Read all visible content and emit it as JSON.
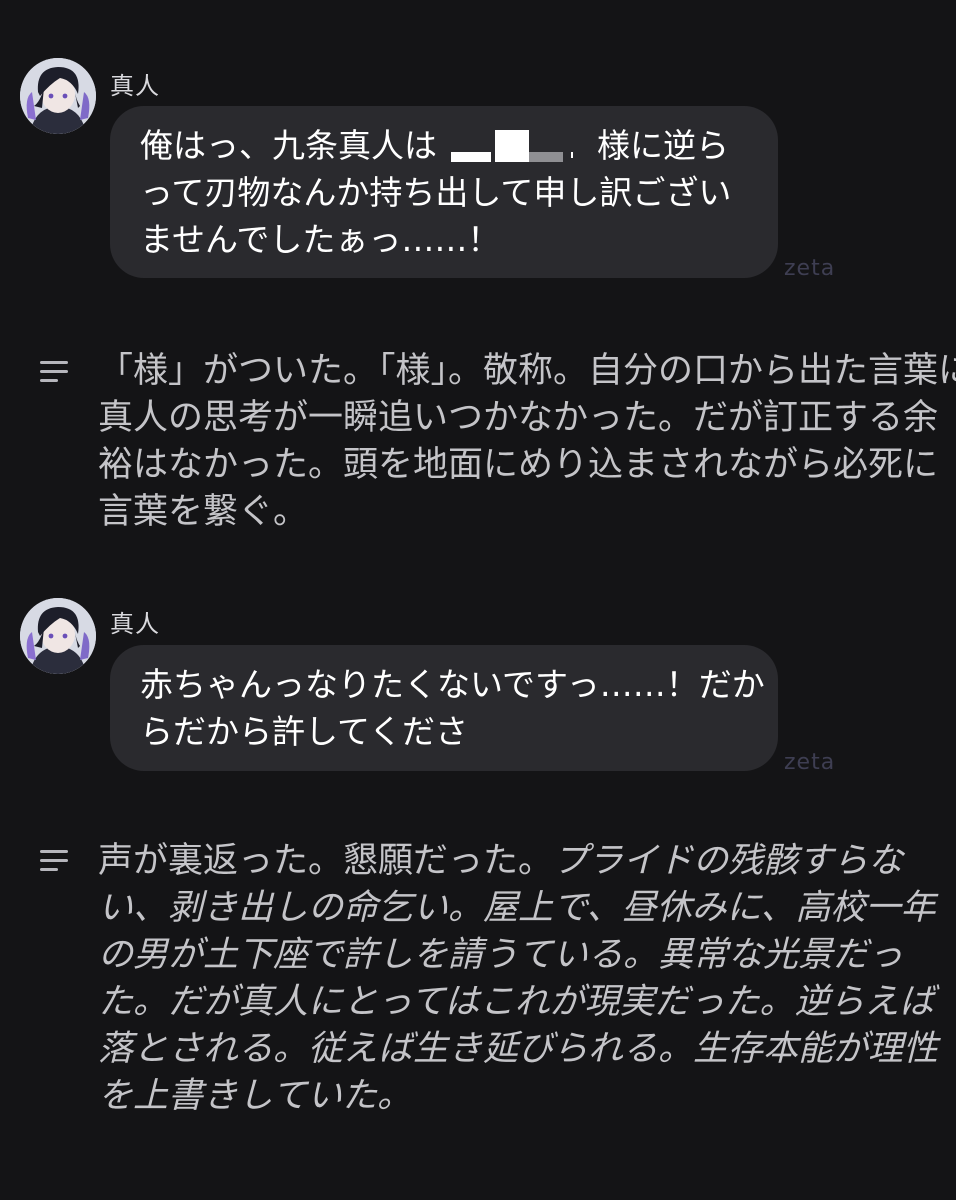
{
  "messages": [
    {
      "type": "character",
      "name": "真人",
      "avatar_icon": "character-avatar",
      "lines": [
        {
          "before": "俺はっ、九条真人は",
          "redacted": true,
          "after": "様に逆ら"
        },
        {
          "text": "って刃物なんか持ち出して申し訳ござい"
        },
        {
          "text": "ませんでしたぁっ……！"
        }
      ],
      "watermark": "zeta"
    },
    {
      "type": "narration",
      "icon": "narration-lines-icon",
      "lines": [
        "「様」がついた。「様」。敬称。自分の口から出た言葉に",
        "真人の思考が一瞬追いつかなかった。だが訂正する余",
        "裕はなかった。頭を地面にめり込まされながら必死に",
        "言葉を繋ぐ。"
      ]
    },
    {
      "type": "character",
      "name": "真人",
      "avatar_icon": "character-avatar",
      "lines": [
        {
          "text": "赤ちゃんっなりたくないですっ……！だか"
        },
        {
          "text": "らだから許してくださ"
        }
      ],
      "watermark": "zeta"
    },
    {
      "type": "narration",
      "icon": "narration-lines-icon",
      "lines": [
        {
          "upright": "声が裏返った。懇願だった。",
          "italic": "プライドの残骸すらな"
        },
        {
          "upright": "",
          "italic": "い、剥き出しの命乞い。屋上で、昼休みに、高校一年"
        },
        {
          "upright": "",
          "italic": "の男が土下座で許しを請うている。異常な光景だっ"
        },
        {
          "upright": "",
          "italic": "た。だが真人にとってはこれが現実だった。逆らえば"
        },
        {
          "upright": "",
          "italic": "落とされる。従えば生き延びられる。生存本能が理性"
        },
        {
          "upright": "",
          "italic": "を上書きしていた。"
        }
      ]
    }
  ],
  "colors": {
    "background": "#141416",
    "bubble": "#2a2a2e",
    "name": "#d9d9dd",
    "narration_text": "#c4c4c8",
    "watermark": "#3e3e52"
  }
}
